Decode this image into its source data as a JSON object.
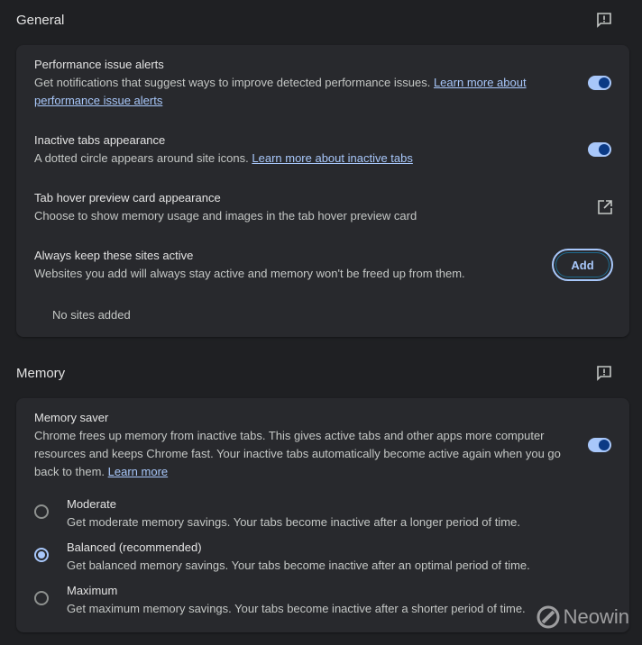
{
  "general": {
    "title": "General",
    "feedback_icon": "feedback-icon",
    "performance_alerts": {
      "title": "Performance issue alerts",
      "desc": "Get notifications that suggest ways to improve detected performance issues. ",
      "link": "Learn more about performance issue alerts",
      "enabled": true
    },
    "inactive_tabs": {
      "title": "Inactive tabs appearance",
      "desc": "A dotted circle appears around site icons. ",
      "link": "Learn more about inactive tabs",
      "enabled": true
    },
    "hover_card": {
      "title": "Tab hover preview card appearance",
      "desc": "Choose to show memory usage and images in the tab hover preview card",
      "icon": "open-in-new-icon"
    },
    "keep_active": {
      "title": "Always keep these sites active",
      "desc": "Websites you add will always stay active and memory won't be freed up from them.",
      "add_label": "Add",
      "empty": "No sites added"
    }
  },
  "memory": {
    "title": "Memory",
    "feedback_icon": "feedback-icon",
    "saver": {
      "title": "Memory saver",
      "desc": "Chrome frees up memory from inactive tabs. This gives active tabs and other apps more computer resources and keeps Chrome fast. Your inactive tabs automatically become active again when you go back to them. ",
      "link": "Learn more",
      "enabled": true
    },
    "options": [
      {
        "label": "Moderate",
        "desc": "Get moderate memory savings. Your tabs become inactive after a longer period of time.",
        "selected": false
      },
      {
        "label": "Balanced (recommended)",
        "desc": "Get balanced memory savings. Your tabs become inactive after an optimal period of time.",
        "selected": true
      },
      {
        "label": "Maximum",
        "desc": "Get maximum memory savings. Your tabs become inactive after a shorter period of time.",
        "selected": false
      }
    ]
  },
  "watermark": "Neowin"
}
